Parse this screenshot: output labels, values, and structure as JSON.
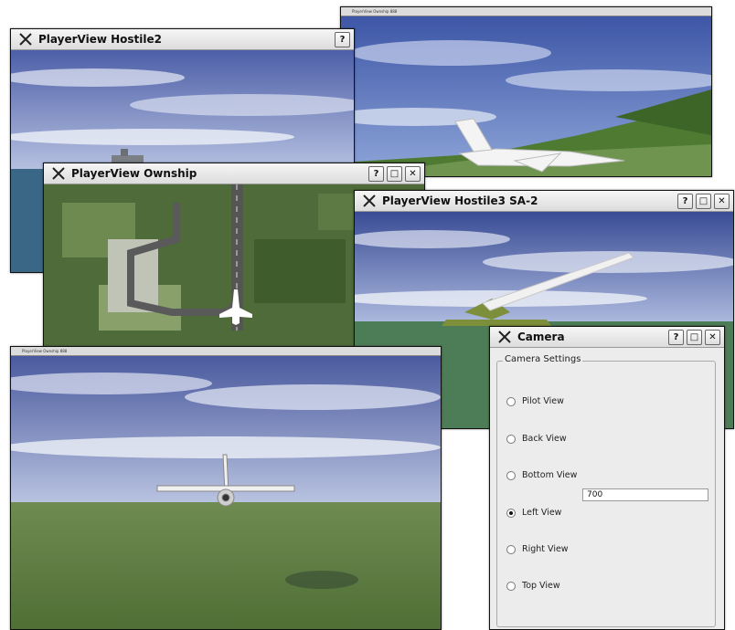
{
  "windows": {
    "hostile2": {
      "title": "PlayerView Hostile2",
      "help": "?"
    },
    "ownship_top": {
      "title": "PlayerView Ownship 888"
    },
    "ownship": {
      "title": "PlayerView Ownship",
      "help": "?",
      "maximize": "□",
      "close": "✕"
    },
    "hostile3": {
      "title": "PlayerView Hostile3 SA-2",
      "help": "?",
      "maximize": "□",
      "close": "✕"
    },
    "ownship_bottom": {
      "title": "PlayerView Ownship 888"
    },
    "camera": {
      "title": "Camera",
      "help": "?",
      "maximize": "□",
      "close": "✕",
      "group_label": "Camera Settings",
      "options": [
        {
          "label": "Pilot View",
          "selected": false
        },
        {
          "label": "Back View",
          "selected": false
        },
        {
          "label": "Bottom View",
          "selected": false
        },
        {
          "label": "Left View",
          "selected": true
        },
        {
          "label": "Right View",
          "selected": false
        },
        {
          "label": "Top View",
          "selected": false
        }
      ],
      "distance_value": "700"
    }
  },
  "icons": {
    "window_logo": "x-logo-icon"
  }
}
